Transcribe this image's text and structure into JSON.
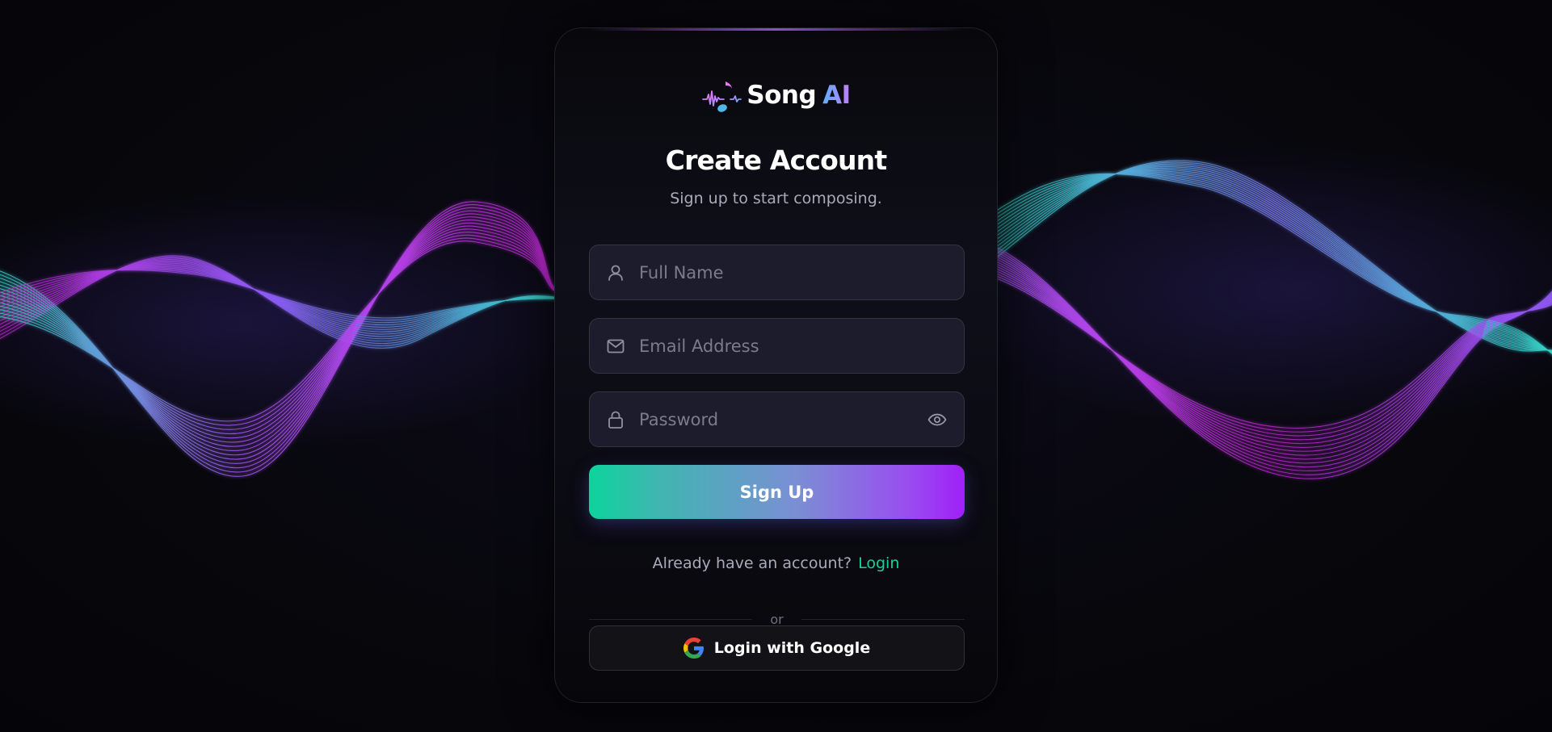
{
  "brand": {
    "name_part1": "Song",
    "name_part2": "AI",
    "logo_icon": "music-note-waveform-icon"
  },
  "header": {
    "title": "Create Account",
    "subtitle": "Sign up to start composing."
  },
  "form": {
    "full_name": {
      "placeholder": "Full Name",
      "value": "",
      "icon": "user-icon"
    },
    "email": {
      "placeholder": "Email Address",
      "value": "",
      "icon": "mail-icon"
    },
    "password": {
      "placeholder": "Password",
      "value": "",
      "icon": "lock-icon",
      "toggle_icon": "eye-icon"
    },
    "submit_label": "Sign Up"
  },
  "account": {
    "prompt": "Already have an account?",
    "login_link": "Login"
  },
  "divider_text": "or",
  "google": {
    "label": "Login with Google",
    "icon": "google-icon"
  },
  "colors": {
    "background": "#07070c",
    "card": "#0c0c14",
    "input_bg": "#1c1c2c",
    "accent_green": "#16d29a",
    "accent_purple": "#a020f8",
    "wave_teal": "#2dd4bf",
    "wave_magenta": "#c026d3"
  }
}
